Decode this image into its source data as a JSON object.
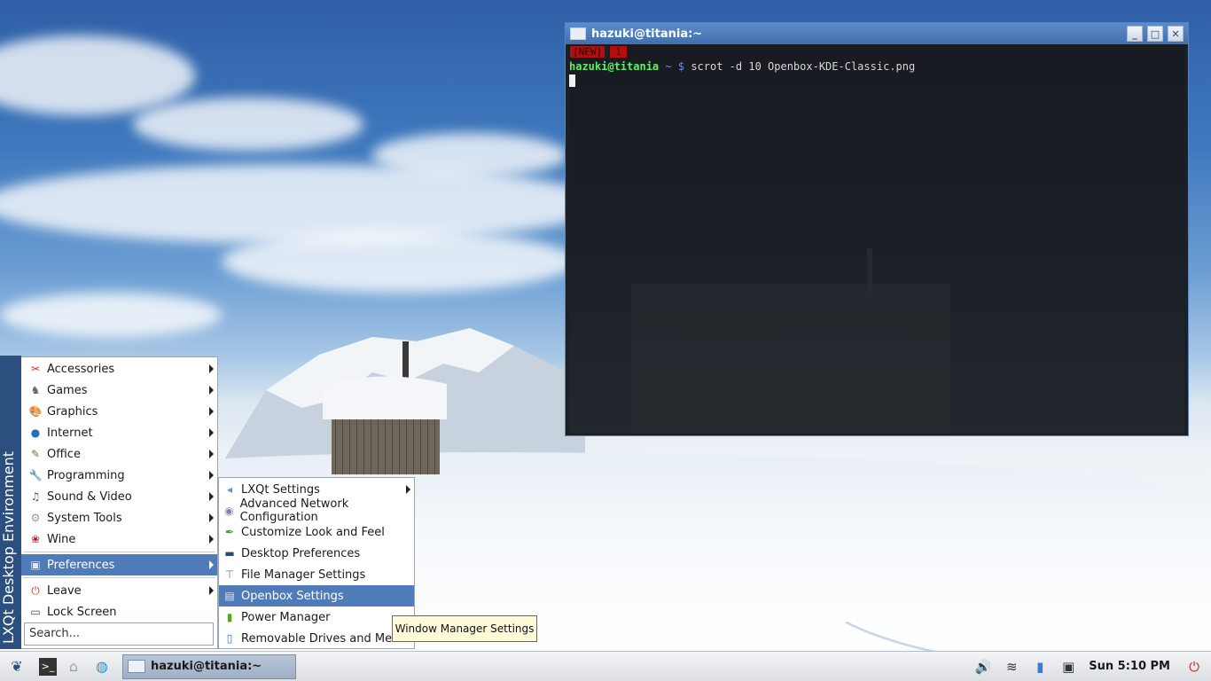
{
  "terminal": {
    "title": "hazuki@titania:~",
    "tmux_new": "[NEW]",
    "tmux_window": "1",
    "prompt_user": "hazuki@titania",
    "prompt_dir": "~",
    "prompt_symbol": "$",
    "command": "scrot -d 10 Openbox-KDE-Classic.png",
    "buttons": {
      "minimize": "_",
      "maximize": "□",
      "close": "✕"
    }
  },
  "start_menu": {
    "side_label": "LXQt Desktop Environment",
    "items": [
      {
        "label": "Accessories",
        "icon": "accessories-icon",
        "submenu": true
      },
      {
        "label": "Games",
        "icon": "games-icon",
        "submenu": true
      },
      {
        "label": "Graphics",
        "icon": "graphics-icon",
        "submenu": true
      },
      {
        "label": "Internet",
        "icon": "internet-icon",
        "submenu": true
      },
      {
        "label": "Office",
        "icon": "office-icon",
        "submenu": true
      },
      {
        "label": "Programming",
        "icon": "programming-icon",
        "submenu": true
      },
      {
        "label": "Sound & Video",
        "icon": "sound-video-icon",
        "submenu": true
      },
      {
        "label": "System Tools",
        "icon": "system-tools-icon",
        "submenu": true
      },
      {
        "label": "Wine",
        "icon": "wine-icon",
        "submenu": true
      },
      {
        "label": "Preferences",
        "icon": "preferences-icon",
        "submenu": true,
        "highlighted": true
      },
      {
        "label": "Leave",
        "icon": "leave-icon",
        "submenu": true
      },
      {
        "label": "Lock Screen",
        "icon": "lock-screen-icon",
        "submenu": false
      }
    ],
    "search_placeholder": "Search..."
  },
  "preferences_submenu": {
    "items": [
      {
        "label": "LXQt Settings",
        "submenu": true
      },
      {
        "label": "Advanced Network Configuration"
      },
      {
        "label": "Customize Look and Feel"
      },
      {
        "label": "Desktop Preferences"
      },
      {
        "label": "File Manager Settings"
      },
      {
        "label": "Openbox Settings",
        "highlighted": true
      },
      {
        "label": "Power Manager"
      },
      {
        "label": "Removable Drives and Media"
      }
    ]
  },
  "tooltip": {
    "text": "Window Manager Settings"
  },
  "taskbar": {
    "task_title": "hazuki@titania:~",
    "clock": "Sun 5:10 PM"
  },
  "colors": {
    "menu_highlight": "#4f7bb8",
    "titlebar": "#4f7bb8",
    "prompt_user": "#5ff05f",
    "tmux_red": "#b40f0f"
  }
}
